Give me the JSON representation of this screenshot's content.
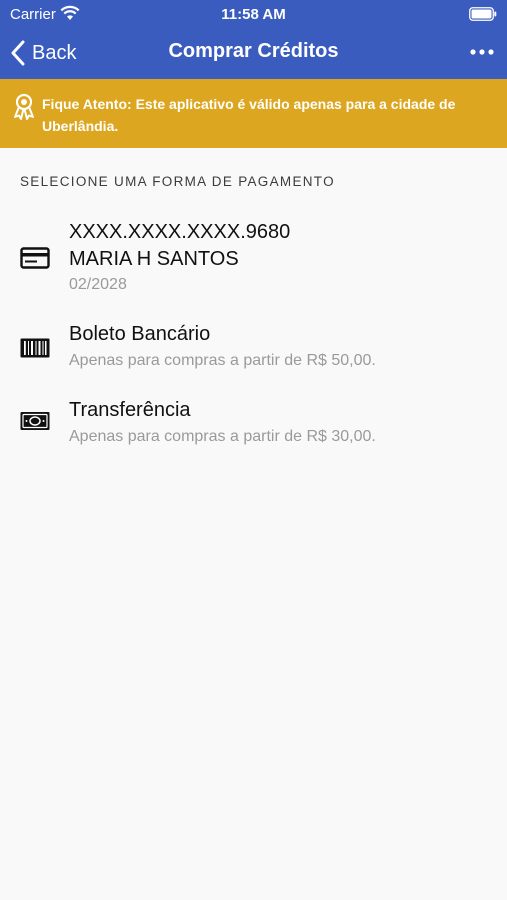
{
  "status_bar": {
    "carrier": "Carrier",
    "time": "11:58 AM"
  },
  "nav": {
    "back_label": "Back",
    "title": "Comprar Créditos"
  },
  "notice": {
    "text": "Fique Atento: Este aplicativo é válido apenas para a cidade de Uberlândia."
  },
  "payment": {
    "section_title": "SELECIONE UMA FORMA DE PAGAMENTO",
    "card": {
      "number": "XXXX.XXXX.XXXX.9680",
      "holder": "MARIA H SANTOS",
      "expiry": "02/2028",
      "icon": "credit-card-icon"
    },
    "boleto": {
      "title": "Boleto Bancário",
      "subtitle": "Apenas para compras a partir de R$ 50,00.",
      "icon": "barcode-icon"
    },
    "transfer": {
      "title": "Transferência",
      "subtitle": "Apenas para compras a partir de R$ 30,00.",
      "icon": "cash-icon"
    }
  },
  "colors": {
    "header": "#3a5cbf",
    "notice": "#dca620",
    "background": "#f9f9f9"
  }
}
